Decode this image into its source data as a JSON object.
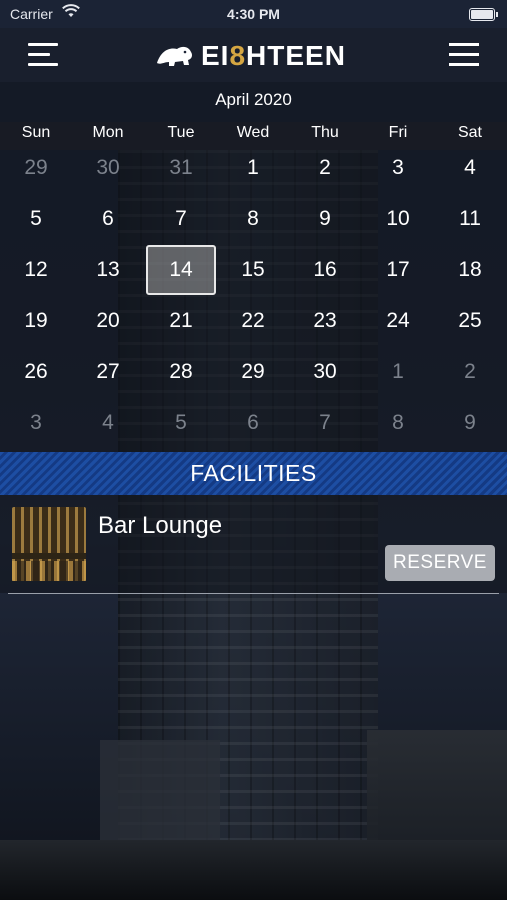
{
  "status_bar": {
    "carrier": "Carrier",
    "time": "4:30 PM",
    "wifi_icon": "wifi-icon",
    "battery_icon": "battery-icon"
  },
  "header": {
    "logo_text_1": "EI",
    "logo_text_gold": "8",
    "logo_text_2": "HTEEN",
    "menu_icon": "hamburger-menu-icon",
    "more_icon": "list-menu-icon"
  },
  "calendar": {
    "month": "April 2020",
    "weekdays": [
      "Sun",
      "Mon",
      "Tue",
      "Wed",
      "Thu",
      "Fri",
      "Sat"
    ],
    "weeks": [
      [
        {
          "d": "29",
          "other": true
        },
        {
          "d": "30",
          "other": true
        },
        {
          "d": "31",
          "other": true
        },
        {
          "d": "1"
        },
        {
          "d": "2"
        },
        {
          "d": "3"
        },
        {
          "d": "4"
        }
      ],
      [
        {
          "d": "5"
        },
        {
          "d": "6"
        },
        {
          "d": "7"
        },
        {
          "d": "8"
        },
        {
          "d": "9"
        },
        {
          "d": "10"
        },
        {
          "d": "11"
        }
      ],
      [
        {
          "d": "12"
        },
        {
          "d": "13"
        },
        {
          "d": "14",
          "selected": true
        },
        {
          "d": "15"
        },
        {
          "d": "16"
        },
        {
          "d": "17"
        },
        {
          "d": "18"
        }
      ],
      [
        {
          "d": "19"
        },
        {
          "d": "20"
        },
        {
          "d": "21"
        },
        {
          "d": "22"
        },
        {
          "d": "23"
        },
        {
          "d": "24"
        },
        {
          "d": "25"
        }
      ],
      [
        {
          "d": "26"
        },
        {
          "d": "27"
        },
        {
          "d": "28"
        },
        {
          "d": "29"
        },
        {
          "d": "30"
        },
        {
          "d": "1",
          "other": true
        },
        {
          "d": "2",
          "other": true
        }
      ],
      [
        {
          "d": "3",
          "other": true
        },
        {
          "d": "4",
          "other": true
        },
        {
          "d": "5",
          "other": true
        },
        {
          "d": "6",
          "other": true
        },
        {
          "d": "7",
          "other": true
        },
        {
          "d": "8",
          "other": true
        },
        {
          "d": "9",
          "other": true
        }
      ]
    ]
  },
  "facilities": {
    "title": "FACILITIES",
    "items": [
      {
        "name": "Bar Lounge",
        "button": "RESERVE"
      }
    ]
  },
  "colors": {
    "accent_blue": "#1d4ea3",
    "gold": "#d5a642",
    "button_gray": "#a9acb2"
  }
}
